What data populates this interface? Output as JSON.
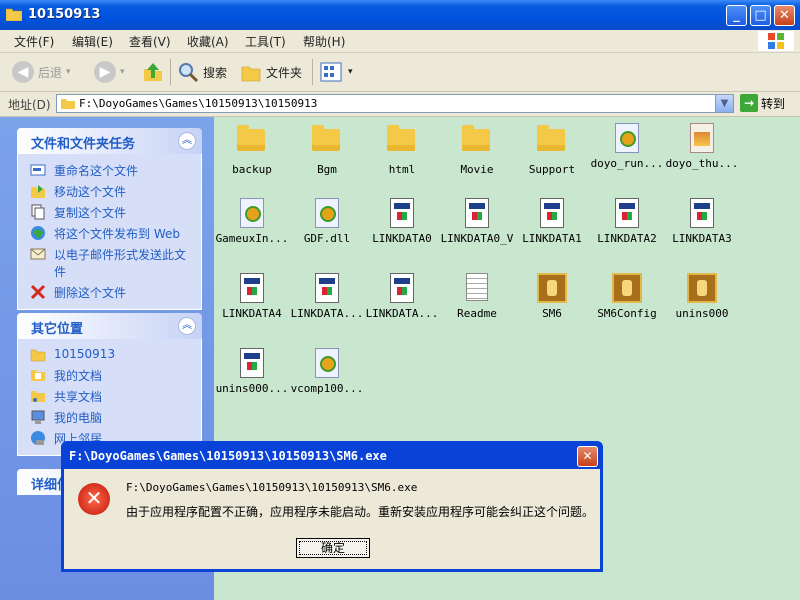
{
  "window": {
    "title": "10150913"
  },
  "menu": [
    "文件(F)",
    "编辑(E)",
    "查看(V)",
    "收藏(A)",
    "工具(T)",
    "帮助(H)"
  ],
  "toolbar": {
    "back": "后退",
    "search": "搜索",
    "folders": "文件夹"
  },
  "address": {
    "label": "地址(D)",
    "path": "F:\\DoyoGames\\Games\\10150913\\10150913",
    "go": "转到"
  },
  "taskpane": {
    "file_tasks_title": "文件和文件夹任务",
    "file_tasks": [
      "重命名这个文件",
      "移动这个文件",
      "复制这个文件",
      "将这个文件发布到 Web",
      "以电子邮件形式发送此文件",
      "删除这个文件"
    ],
    "other_places_title": "其它位置",
    "other_places": [
      "10150913",
      "我的文档",
      "共享文档",
      "我的电脑",
      "网上邻居"
    ],
    "details_title": "详细信"
  },
  "files": [
    {
      "name": "backup",
      "icon": "folder-icon"
    },
    {
      "name": "Bgm",
      "icon": "folder-icon"
    },
    {
      "name": "html",
      "icon": "folder-icon"
    },
    {
      "name": "Movie",
      "icon": "folder-icon"
    },
    {
      "name": "Support",
      "icon": "folder-icon"
    },
    {
      "name": "doyo_run...",
      "icon": "exe-icon"
    },
    {
      "name": "doyo_thu...",
      "icon": "thumb-icon"
    },
    {
      "name": "GameuxIn...",
      "icon": "exe-icon"
    },
    {
      "name": "GDF.dll",
      "icon": "exe-icon"
    },
    {
      "name": "LINKDATA0",
      "icon": "window-file-icon"
    },
    {
      "name": "LINKDATA0_V",
      "icon": "window-file-icon"
    },
    {
      "name": "LINKDATA1",
      "icon": "window-file-icon"
    },
    {
      "name": "LINKDATA2",
      "icon": "window-file-icon"
    },
    {
      "name": "LINKDATA3",
      "icon": "window-file-icon"
    },
    {
      "name": "LINKDATA4",
      "icon": "window-file-icon"
    },
    {
      "name": "LINKDATA...",
      "icon": "window-file-icon"
    },
    {
      "name": "LINKDATA...",
      "icon": "window-file-icon"
    },
    {
      "name": "Readme",
      "icon": "text-file-icon"
    },
    {
      "name": "SM6",
      "icon": "game-icon"
    },
    {
      "name": "SM6Config",
      "icon": "game-icon"
    },
    {
      "name": "unins000",
      "icon": "game-icon"
    },
    {
      "name": "unins000...",
      "icon": "window-file-icon"
    },
    {
      "name": "vcomp100...",
      "icon": "exe-icon"
    }
  ],
  "dialog": {
    "title": "F:\\DoyoGames\\Games\\10150913\\10150913\\SM6.exe",
    "path": "F:\\DoyoGames\\Games\\10150913\\10150913\\SM6.exe",
    "message": "由于应用程序配置不正确，应用程序未能启动。重新安装应用程序可能会纠正这个问题。",
    "ok": "确定"
  }
}
